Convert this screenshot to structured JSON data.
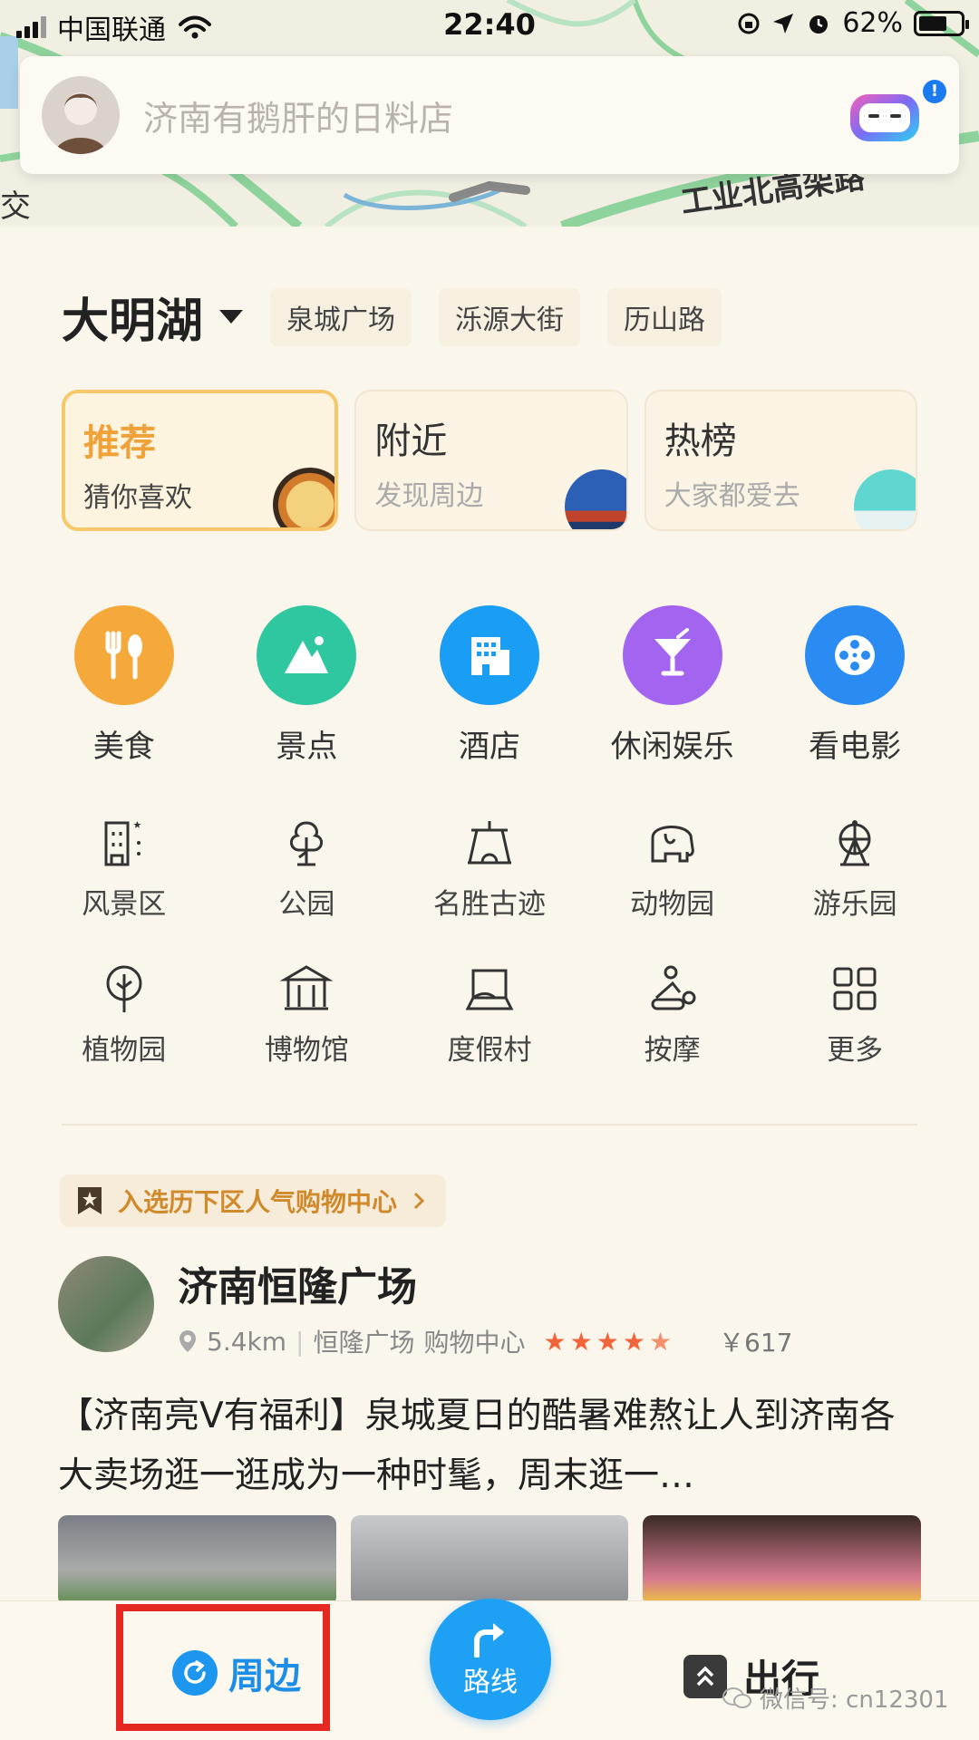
{
  "status_bar": {
    "carrier": "中国联通",
    "time": "22:40",
    "battery": "62%"
  },
  "map": {
    "labels": [
      "交",
      "工业北高架路"
    ]
  },
  "search": {
    "placeholder": "济南有鹅肝的日料店"
  },
  "location": {
    "current": "大明湖",
    "nearby_tags": [
      "泉城广场",
      "泺源大街",
      "历山路"
    ]
  },
  "cards": [
    {
      "title": "推荐",
      "subtitle": "猜你喜欢",
      "active": true
    },
    {
      "title": "附近",
      "subtitle": "发现周边",
      "active": false
    },
    {
      "title": "热榜",
      "subtitle": "大家都爱去",
      "active": false
    }
  ],
  "main_categories": [
    {
      "label": "美食",
      "icon": "fork-spoon-icon",
      "color": "#f6a93b"
    },
    {
      "label": "景点",
      "icon": "mountain-icon",
      "color": "#2fc7a0"
    },
    {
      "label": "酒店",
      "icon": "building-icon",
      "color": "#1a9ef5"
    },
    {
      "label": "休闲娱乐",
      "icon": "cocktail-icon",
      "color": "#a365f0"
    },
    {
      "label": "看电影",
      "icon": "film-reel-icon",
      "color": "#2a8cf3"
    }
  ],
  "sub_categories": [
    {
      "label": "风景区",
      "icon": "scenic-area-icon"
    },
    {
      "label": "公园",
      "icon": "park-tree-icon"
    },
    {
      "label": "名胜古迹",
      "icon": "monument-icon"
    },
    {
      "label": "动物园",
      "icon": "elephant-icon"
    },
    {
      "label": "游乐园",
      "icon": "ferris-wheel-icon"
    },
    {
      "label": "植物园",
      "icon": "plant-icon"
    },
    {
      "label": "博物馆",
      "icon": "museum-icon"
    },
    {
      "label": "度假村",
      "icon": "resort-icon"
    },
    {
      "label": "按摩",
      "icon": "massage-icon"
    },
    {
      "label": "更多",
      "icon": "grid-more-icon"
    }
  ],
  "feed": {
    "tag": "入选历下区人气购物中心",
    "title": "济南恒隆广场",
    "distance": "5.4km",
    "area": "恒隆广场",
    "category": "购物中心",
    "rating": 4.5,
    "price": "￥617",
    "description": "【济南亮V有福利】泉城夏日的酷暑难熬让人到济南各大卖场逛一逛成为一种时髦，周末逛一…"
  },
  "bottom_nav": {
    "nearby": "周边",
    "route": "路线",
    "travel": "出行"
  },
  "watermark": "微信号: cn12301"
}
